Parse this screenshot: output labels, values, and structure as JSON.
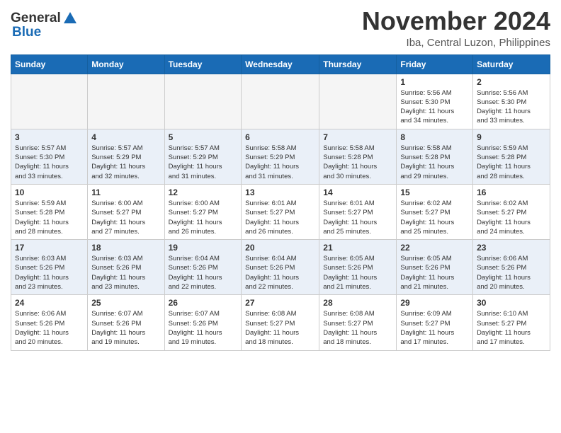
{
  "header": {
    "logo_general": "General",
    "logo_blue": "Blue",
    "month_title": "November 2024",
    "location": "Iba, Central Luzon, Philippines"
  },
  "weekdays": [
    "Sunday",
    "Monday",
    "Tuesday",
    "Wednesday",
    "Thursday",
    "Friday",
    "Saturday"
  ],
  "weeks": [
    [
      {
        "day": "",
        "info": ""
      },
      {
        "day": "",
        "info": ""
      },
      {
        "day": "",
        "info": ""
      },
      {
        "day": "",
        "info": ""
      },
      {
        "day": "",
        "info": ""
      },
      {
        "day": "1",
        "info": "Sunrise: 5:56 AM\nSunset: 5:30 PM\nDaylight: 11 hours\nand 34 minutes."
      },
      {
        "day": "2",
        "info": "Sunrise: 5:56 AM\nSunset: 5:30 PM\nDaylight: 11 hours\nand 33 minutes."
      }
    ],
    [
      {
        "day": "3",
        "info": "Sunrise: 5:57 AM\nSunset: 5:30 PM\nDaylight: 11 hours\nand 33 minutes."
      },
      {
        "day": "4",
        "info": "Sunrise: 5:57 AM\nSunset: 5:29 PM\nDaylight: 11 hours\nand 32 minutes."
      },
      {
        "day": "5",
        "info": "Sunrise: 5:57 AM\nSunset: 5:29 PM\nDaylight: 11 hours\nand 31 minutes."
      },
      {
        "day": "6",
        "info": "Sunrise: 5:58 AM\nSunset: 5:29 PM\nDaylight: 11 hours\nand 31 minutes."
      },
      {
        "day": "7",
        "info": "Sunrise: 5:58 AM\nSunset: 5:28 PM\nDaylight: 11 hours\nand 30 minutes."
      },
      {
        "day": "8",
        "info": "Sunrise: 5:58 AM\nSunset: 5:28 PM\nDaylight: 11 hours\nand 29 minutes."
      },
      {
        "day": "9",
        "info": "Sunrise: 5:59 AM\nSunset: 5:28 PM\nDaylight: 11 hours\nand 28 minutes."
      }
    ],
    [
      {
        "day": "10",
        "info": "Sunrise: 5:59 AM\nSunset: 5:28 PM\nDaylight: 11 hours\nand 28 minutes."
      },
      {
        "day": "11",
        "info": "Sunrise: 6:00 AM\nSunset: 5:27 PM\nDaylight: 11 hours\nand 27 minutes."
      },
      {
        "day": "12",
        "info": "Sunrise: 6:00 AM\nSunset: 5:27 PM\nDaylight: 11 hours\nand 26 minutes."
      },
      {
        "day": "13",
        "info": "Sunrise: 6:01 AM\nSunset: 5:27 PM\nDaylight: 11 hours\nand 26 minutes."
      },
      {
        "day": "14",
        "info": "Sunrise: 6:01 AM\nSunset: 5:27 PM\nDaylight: 11 hours\nand 25 minutes."
      },
      {
        "day": "15",
        "info": "Sunrise: 6:02 AM\nSunset: 5:27 PM\nDaylight: 11 hours\nand 25 minutes."
      },
      {
        "day": "16",
        "info": "Sunrise: 6:02 AM\nSunset: 5:27 PM\nDaylight: 11 hours\nand 24 minutes."
      }
    ],
    [
      {
        "day": "17",
        "info": "Sunrise: 6:03 AM\nSunset: 5:26 PM\nDaylight: 11 hours\nand 23 minutes."
      },
      {
        "day": "18",
        "info": "Sunrise: 6:03 AM\nSunset: 5:26 PM\nDaylight: 11 hours\nand 23 minutes."
      },
      {
        "day": "19",
        "info": "Sunrise: 6:04 AM\nSunset: 5:26 PM\nDaylight: 11 hours\nand 22 minutes."
      },
      {
        "day": "20",
        "info": "Sunrise: 6:04 AM\nSunset: 5:26 PM\nDaylight: 11 hours\nand 22 minutes."
      },
      {
        "day": "21",
        "info": "Sunrise: 6:05 AM\nSunset: 5:26 PM\nDaylight: 11 hours\nand 21 minutes."
      },
      {
        "day": "22",
        "info": "Sunrise: 6:05 AM\nSunset: 5:26 PM\nDaylight: 11 hours\nand 21 minutes."
      },
      {
        "day": "23",
        "info": "Sunrise: 6:06 AM\nSunset: 5:26 PM\nDaylight: 11 hours\nand 20 minutes."
      }
    ],
    [
      {
        "day": "24",
        "info": "Sunrise: 6:06 AM\nSunset: 5:26 PM\nDaylight: 11 hours\nand 20 minutes."
      },
      {
        "day": "25",
        "info": "Sunrise: 6:07 AM\nSunset: 5:26 PM\nDaylight: 11 hours\nand 19 minutes."
      },
      {
        "day": "26",
        "info": "Sunrise: 6:07 AM\nSunset: 5:26 PM\nDaylight: 11 hours\nand 19 minutes."
      },
      {
        "day": "27",
        "info": "Sunrise: 6:08 AM\nSunset: 5:27 PM\nDaylight: 11 hours\nand 18 minutes."
      },
      {
        "day": "28",
        "info": "Sunrise: 6:08 AM\nSunset: 5:27 PM\nDaylight: 11 hours\nand 18 minutes."
      },
      {
        "day": "29",
        "info": "Sunrise: 6:09 AM\nSunset: 5:27 PM\nDaylight: 11 hours\nand 17 minutes."
      },
      {
        "day": "30",
        "info": "Sunrise: 6:10 AM\nSunset: 5:27 PM\nDaylight: 11 hours\nand 17 minutes."
      }
    ]
  ],
  "colors": {
    "header_bg": "#1a6bb5",
    "row_even": "#eaf0f8",
    "row_odd": "#ffffff",
    "empty_cell": "#f5f5f5"
  }
}
